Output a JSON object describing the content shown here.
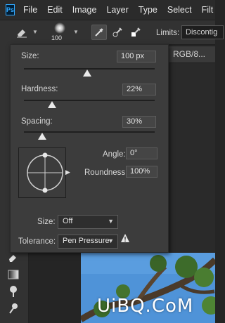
{
  "menubar": {
    "logo_text": "Ps",
    "items": [
      "File",
      "Edit",
      "Image",
      "Layer",
      "Type",
      "Select",
      "Filt"
    ]
  },
  "options_bar": {
    "brush_size_value": "100",
    "limits_label": "Limits:",
    "limits_value": "Discontig",
    "icons": [
      "eraser-tool-icon",
      "brush-preset-picker",
      "brush-settings-icon",
      "sample-continuous-icon",
      "sample-once-icon",
      "sample-background-swatch-icon"
    ]
  },
  "document_tab": {
    "label": "RGB/8..."
  },
  "brush_panel": {
    "size": {
      "label": "Size:",
      "value": "100 px",
      "slider_fraction": 0.45
    },
    "hardness": {
      "label": "Hardness:",
      "value": "22%",
      "slider_fraction": 0.22
    },
    "spacing": {
      "label": "Spacing:",
      "value": "30%",
      "slider_fraction": 0.14
    },
    "angle": {
      "label": "Angle:",
      "value": "0°"
    },
    "roundness": {
      "label": "Roundness:",
      "value": "100%"
    },
    "size_control": {
      "label": "Size:",
      "value": "Off"
    },
    "tolerance": {
      "label": "Tolerance:",
      "value": "Pen Pressure"
    }
  },
  "tools": [
    "background-eraser-tool-icon",
    "gradient-tool-icon",
    "dodge-tool-icon",
    "pen-tool-icon"
  ],
  "watermark": {
    "text": "UiBQ.CoM"
  },
  "colors": {
    "accent": "#31a8ff",
    "panel": "#3c3c3c",
    "sky": "#4a8fd6"
  }
}
